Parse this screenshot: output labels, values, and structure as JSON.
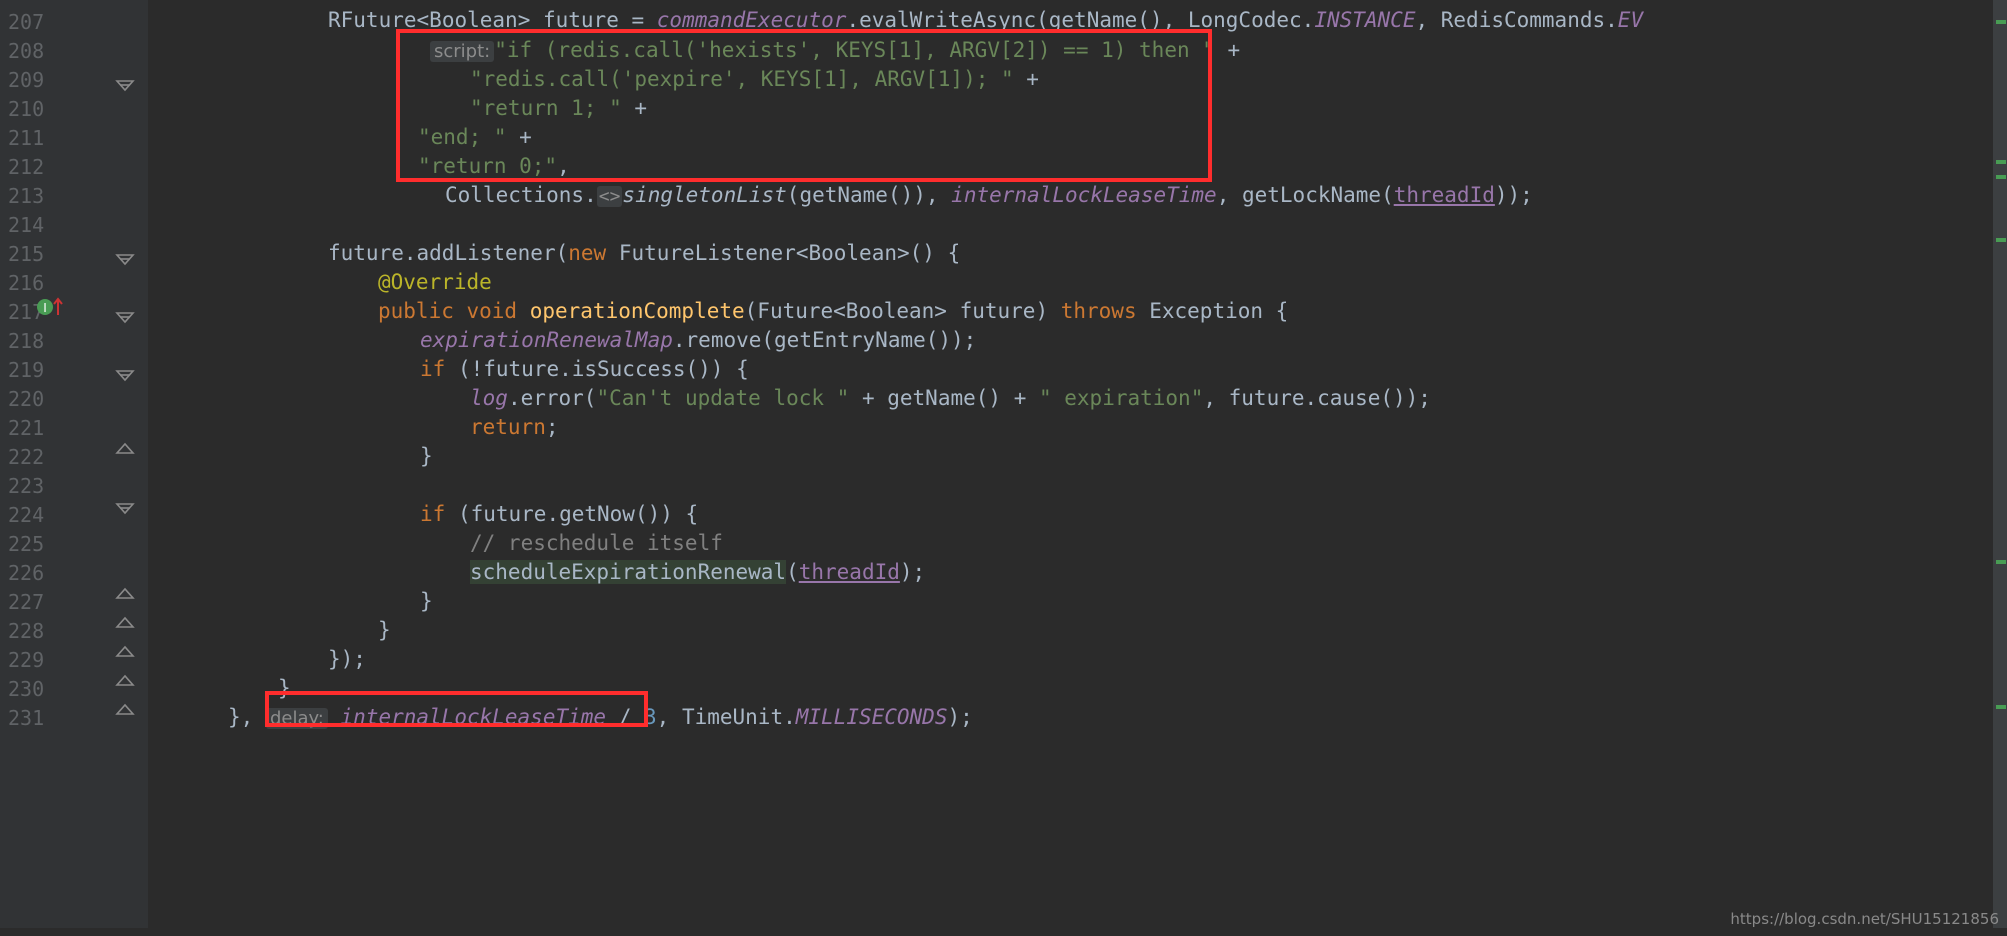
{
  "editor": {
    "theme": "darcula",
    "background_color": "#2b2b2b",
    "gutter_color": "#313335",
    "line_number_color": "#606366",
    "annotation_color": "#ff2d2d",
    "usage_highlight_color": "#344134",
    "hint_background": "#3c3f41"
  },
  "line_numbers": [
    "207",
    "208",
    "209",
    "210",
    "211",
    "212",
    "213",
    "214",
    "215",
    "216",
    "217",
    "218",
    "219",
    "220",
    "221",
    "222",
    "223",
    "224",
    "225",
    "226",
    "227",
    "228",
    "229",
    "230",
    "231"
  ],
  "code_lines": [
    {
      "number": "207",
      "text": "            RFuture<Boolean> future = commandExecutor.evalWriteAsync(getName(), LongCodec.INSTANCE, RedisCommands.EV"
    },
    {
      "number": "208",
      "text": "                    script: \"if (redis.call('hexists', KEYS[1], ARGV[2]) == 1) then \" +"
    },
    {
      "number": "209",
      "text": "                        \"redis.call('pexpire', KEYS[1], ARGV[1]); \" +"
    },
    {
      "number": "210",
      "text": "                        \"return 1; \" +"
    },
    {
      "number": "211",
      "text": "                    \"end; \" +"
    },
    {
      "number": "212",
      "text": "                    \"return 0;\","
    },
    {
      "number": "213",
      "text": "                    Collections.<>singletonList(getName()), internalLockLeaseTime, getLockName(threadId));"
    },
    {
      "number": "214",
      "text": ""
    },
    {
      "number": "215",
      "text": "            future.addListener(new FutureListener<Boolean>() {"
    },
    {
      "number": "216",
      "text": "                @Override"
    },
    {
      "number": "217",
      "text": "                public void operationComplete(Future<Boolean> future) throws Exception {"
    },
    {
      "number": "218",
      "text": "                    expirationRenewalMap.remove(getEntryName());"
    },
    {
      "number": "219",
      "text": "                    if (!future.isSuccess()) {"
    },
    {
      "number": "220",
      "text": "                        log.error(\"Can't update lock \" + getName() + \" expiration\", future.cause());"
    },
    {
      "number": "221",
      "text": "                        return;"
    },
    {
      "number": "222",
      "text": "                    }"
    },
    {
      "number": "223",
      "text": ""
    },
    {
      "number": "224",
      "text": "                    if (future.getNow()) {"
    },
    {
      "number": "225",
      "text": "                        // reschedule itself"
    },
    {
      "number": "226",
      "text": "                        scheduleExpirationRenewal(threadId);"
    },
    {
      "number": "227",
      "text": "                    }"
    },
    {
      "number": "228",
      "text": "                }"
    },
    {
      "number": "229",
      "text": "            });"
    },
    {
      "number": "230",
      "text": "        }"
    },
    {
      "number": "231",
      "text": "    }, delay: internalLockLeaseTime / 3, TimeUnit.MILLISECONDS);"
    }
  ],
  "tokens": {
    "l207": {
      "type_rfuture": "RFuture",
      "generic_open": "<",
      "generic_boolean": "Boolean",
      "generic_close": ">",
      "var_future": " future = ",
      "command_executor": "commandExecutor",
      "dot1": ".",
      "method_eval": "evalWriteAsync",
      "paren_open": "(",
      "get_name": "getName",
      "get_name_parens": "(), ",
      "long_codec": "LongCodec",
      "dot2": ".",
      "instance": "INSTANCE",
      "comma": ", ",
      "redis_commands": "RedisCommands",
      "dot3": ".",
      "eval_trunc": "EV"
    },
    "l208": {
      "hint_script": "script:",
      "string": "\"if (redis.call('hexists', KEYS[1], ARGV[2]) == 1) then \"",
      "plus": " +"
    },
    "l209": {
      "string": "\"redis.call('pexpire', KEYS[1], ARGV[1]); \"",
      "plus": " +"
    },
    "l210": {
      "string": "\"return 1; \"",
      "plus": " +"
    },
    "l211": {
      "string": "\"end; \"",
      "plus": " +"
    },
    "l212": {
      "string": "\"return 0;\"",
      "comma": ","
    },
    "l213": {
      "collections": "Collections",
      "dot": ".",
      "diamond": "<>",
      "singleton_list": "singletonList",
      "args": "(getName()), ",
      "internal_lock_lease_time": "internalLockLeaseTime",
      "comma": ", ",
      "get_lock_name": "getLockName",
      "paren_open": "(",
      "thread_id": "threadId",
      "tail": "));"
    },
    "l215": {
      "future": "future",
      "dot": ".",
      "add_listener": "addListener",
      "paren_open": "(",
      "kw_new": "new",
      "future_listener": " FutureListener",
      "generic": "<Boolean>",
      "tail": "() {"
    },
    "l216": {
      "override": "@Override"
    },
    "l217": {
      "modifiers": "public void ",
      "method": "operationComplete",
      "params": "(Future<Boolean> future) ",
      "throws": "throws",
      "exception": " Exception {"
    },
    "l218": {
      "field": "expirationRenewalMap",
      "dot": ".",
      "remove": "remove(getEntryName());"
    },
    "l219": {
      "kw_if": "if",
      "cond": " (!future.isSuccess()) {"
    },
    "l220": {
      "log": "log",
      "dot": ".",
      "error": "error(",
      "str1": "\"Can't update lock \"",
      "plus1": " + getName() + ",
      "str2": "\" expiration\"",
      "tail": ", future.cause());"
    },
    "l221": {
      "kw_return": "return",
      "semi": ";"
    },
    "l222": {
      "brace": "}"
    },
    "l224": {
      "kw_if": "if",
      "cond": " (future.getNow()) {"
    },
    "l225": {
      "comment": "// reschedule itself"
    },
    "l226": {
      "method_hl": "scheduleExpirationRenewal",
      "paren_open": "(",
      "thread_id": "threadId",
      "tail": ");"
    },
    "l227": {
      "brace": "}"
    },
    "l228": {
      "brace": "}"
    },
    "l229": {
      "text": "});"
    },
    "l230": {
      "brace": "}"
    },
    "l231": {
      "lead": "}, ",
      "hint_delay": "delay:",
      "internal_lock_lease_time": " internalLockLeaseTime",
      "slash": " / ",
      "three": "3",
      "comma": ",",
      "time_unit": " TimeUnit",
      "dot": ".",
      "milliseconds": "MILLISECONDS",
      "tail": ");"
    }
  },
  "annotations": [
    {
      "name": "script-argument-highlight-box",
      "label": "red rectangle around script lines 208-212"
    },
    {
      "name": "delay-argument-highlight-box",
      "label": "red rectangle around delay argument on line 231"
    }
  ],
  "gutter": {
    "fold_lines": [
      "208",
      "215",
      "217",
      "219",
      "222",
      "224",
      "227",
      "228",
      "229",
      "230",
      "231"
    ],
    "breakpoint_line": "217",
    "breakpoint_icon": "override-method-arrow-icon"
  },
  "watermark": {
    "text": "https://blog.csdn.net/SHU15121856"
  }
}
